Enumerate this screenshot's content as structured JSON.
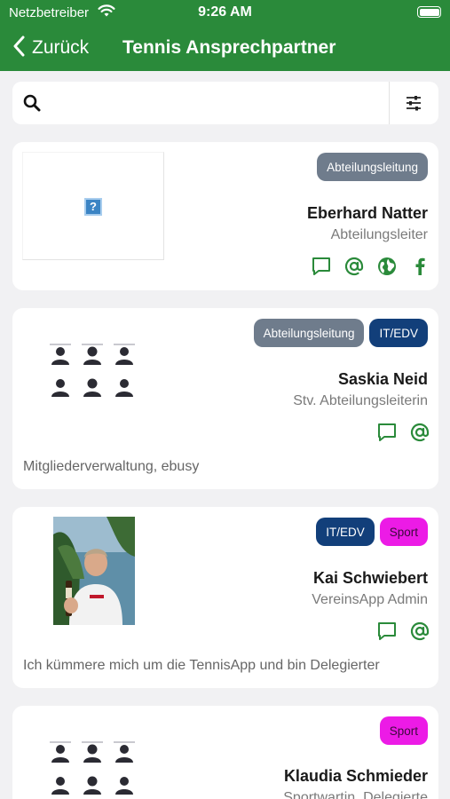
{
  "status_bar": {
    "carrier": "Netzbetreiber",
    "time": "9:26 AM"
  },
  "nav": {
    "back_label": "Zurück",
    "title": "Tennis Ansprechpartner"
  },
  "search": {
    "value": "",
    "placeholder": ""
  },
  "colors": {
    "brand": "#2a8a3a",
    "tag_gray": "#6f7c8c",
    "tag_navy": "#123f7a",
    "tag_magenta": "#ec1be6"
  },
  "contacts": [
    {
      "tags": [
        "Abteilungsleitung"
      ],
      "name": "Eberhard Natter",
      "role": "Abteilungsleiter",
      "actions": [
        "chat-icon",
        "at-icon",
        "globe-icon",
        "facebook-icon"
      ],
      "description": "",
      "photo": "missing-image-icon"
    },
    {
      "tags": [
        "Abteilungsleitung",
        "IT/EDV"
      ],
      "name": "Saskia Neid",
      "role": "Stv. Abteilungsleiterin",
      "actions": [
        "chat-icon",
        "at-icon"
      ],
      "description": "Mitgliederverwaltung, ebusy",
      "photo": "avatar-placeholder-icon"
    },
    {
      "tags": [
        "IT/EDV",
        "Sport"
      ],
      "name": "Kai Schwiebert",
      "role": "VereinsApp Admin",
      "actions": [
        "chat-icon",
        "at-icon"
      ],
      "description": "Ich kümmere mich um die TennisApp und bin Delegierter",
      "photo": "person-photo"
    },
    {
      "tags": [
        "Sport"
      ],
      "name": "Klaudia Schmieder",
      "role": "Sportwartin, Delegierte",
      "actions": [],
      "description": "",
      "photo": "avatar-placeholder-icon"
    }
  ]
}
